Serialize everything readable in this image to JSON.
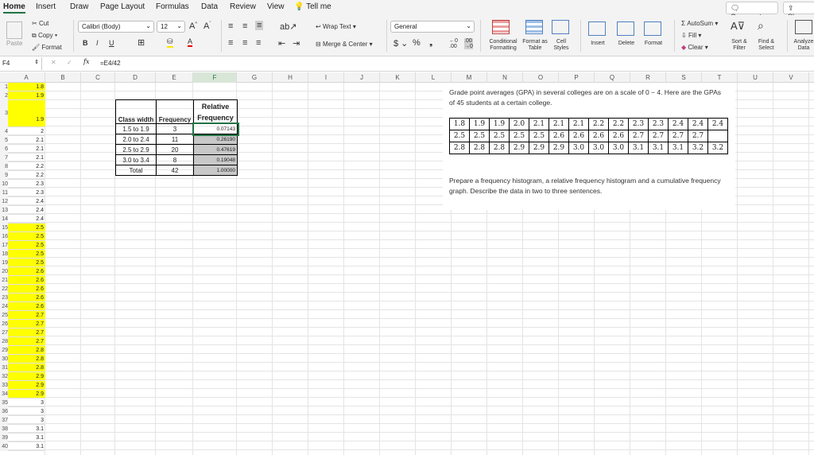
{
  "menu": {
    "tabs": [
      "Home",
      "Insert",
      "Draw",
      "Page Layout",
      "Formulas",
      "Data",
      "Review",
      "View"
    ],
    "tell_me": "Tell me",
    "comments": "Comments",
    "share": "Share"
  },
  "ribbon": {
    "paste": "Paste",
    "cut": "Cut",
    "copy": "Copy",
    "format": "Format",
    "font_name": "Calibri (Body)",
    "font_size": "12",
    "wrap_text": "Wrap Text",
    "merge_center": "Merge & Center",
    "number_format": "General",
    "conditional_formatting": "Conditional Formatting",
    "format_as_table": "Format as Table",
    "cell_styles": "Cell Styles",
    "insert": "Insert",
    "delete": "Delete",
    "format_cells": "Format",
    "autosum": "AutoSum",
    "fill": "Fill",
    "clear": "Clear",
    "sort_filter": "Sort & Filter",
    "find_select": "Find & Select",
    "analyze_data": "Analyze Data"
  },
  "formula_bar": {
    "name_box": "F4",
    "fx": "fx",
    "formula": "=E4/42"
  },
  "columns": [
    "A",
    "B",
    "C",
    "D",
    "E",
    "F",
    "G",
    "H",
    "I",
    "J",
    "K",
    "L",
    "M",
    "N",
    "O",
    "P",
    "Q",
    "R",
    "S",
    "T",
    "U",
    "V"
  ],
  "col_a": [
    {
      "row": "1",
      "v": "1.8",
      "y": true
    },
    {
      "row": "2",
      "v": "1.9",
      "y": true
    },
    {
      "row": "3",
      "v": "1.9",
      "y": true
    },
    {
      "row": "4",
      "v": "2",
      "y": false
    },
    {
      "row": "5",
      "v": "2.1",
      "y": false
    },
    {
      "row": "6",
      "v": "2.1",
      "y": false
    },
    {
      "row": "7",
      "v": "2.1",
      "y": false
    },
    {
      "row": "8",
      "v": "2.2",
      "y": false
    },
    {
      "row": "9",
      "v": "2.2",
      "y": false
    },
    {
      "row": "10",
      "v": "2.3",
      "y": false
    },
    {
      "row": "11",
      "v": "2.3",
      "y": false
    },
    {
      "row": "12",
      "v": "2.4",
      "y": false
    },
    {
      "row": "13",
      "v": "2.4",
      "y": false
    },
    {
      "row": "14",
      "v": "2.4",
      "y": false
    },
    {
      "row": "15",
      "v": "2.5",
      "y": true
    },
    {
      "row": "16",
      "v": "2.5",
      "y": true
    },
    {
      "row": "17",
      "v": "2.5",
      "y": true
    },
    {
      "row": "18",
      "v": "2.5",
      "y": true
    },
    {
      "row": "19",
      "v": "2.5",
      "y": true
    },
    {
      "row": "20",
      "v": "2.6",
      "y": true
    },
    {
      "row": "21",
      "v": "2.6",
      "y": true
    },
    {
      "row": "22",
      "v": "2.6",
      "y": true
    },
    {
      "row": "23",
      "v": "2.6",
      "y": true
    },
    {
      "row": "24",
      "v": "2.6",
      "y": true
    },
    {
      "row": "25",
      "v": "2.7",
      "y": true
    },
    {
      "row": "26",
      "v": "2.7",
      "y": true
    },
    {
      "row": "27",
      "v": "2.7",
      "y": true
    },
    {
      "row": "28",
      "v": "2.7",
      "y": true
    },
    {
      "row": "29",
      "v": "2.8",
      "y": true
    },
    {
      "row": "30",
      "v": "2.8",
      "y": true
    },
    {
      "row": "31",
      "v": "2.8",
      "y": true
    },
    {
      "row": "32",
      "v": "2.9",
      "y": true
    },
    {
      "row": "33",
      "v": "2.9",
      "y": true
    },
    {
      "row": "34",
      "v": "2.9",
      "y": true
    },
    {
      "row": "35",
      "v": "3",
      "y": false
    },
    {
      "row": "36",
      "v": "3",
      "y": false
    },
    {
      "row": "37",
      "v": "3",
      "y": false
    },
    {
      "row": "38",
      "v": "3.1",
      "y": false
    },
    {
      "row": "39",
      "v": "3.1",
      "y": false
    },
    {
      "row": "40",
      "v": "3.1",
      "y": false
    }
  ],
  "freq_table": {
    "headers": {
      "class_width": "Class width",
      "frequency": "Frequency",
      "relative": "Relative",
      "relative2": "Frequency"
    },
    "rows": [
      {
        "cls": "1.5 to 1.9",
        "freq": "3",
        "rel": "0.07143"
      },
      {
        "cls": "2.0 to 2.4",
        "freq": "11",
        "rel": "0.26190"
      },
      {
        "cls": "2.5 to 2.9",
        "freq": "20",
        "rel": "0.47619"
      },
      {
        "cls": "3.0 to 3.4",
        "freq": "8",
        "rel": "0.19048"
      }
    ],
    "total": {
      "label": "Total",
      "freq": "42",
      "rel": "1.00000"
    }
  },
  "problem": {
    "intro": "Grade point averages (GPA) in several colleges are on a scale of 0 − 4. Here are the GPAs of 45 students at a certain college.",
    "gpa_rows": [
      [
        "1.8",
        "1.9",
        "1.9",
        "2.0",
        "2.1",
        "2.1",
        "2.1",
        "2.2",
        "2.2",
        "2.3",
        "2.3",
        "2.4",
        "2.4",
        "2.4"
      ],
      [
        "2.5",
        "2.5",
        "2.5",
        "2.5",
        "2.5",
        "2.6",
        "2.6",
        "2.6",
        "2.6",
        "2.7",
        "2.7",
        "2.7",
        "2.7"
      ],
      [
        "2.8",
        "2.8",
        "2.8",
        "2.9",
        "2.9",
        "2.9",
        "3.0",
        "3.0",
        "3.0",
        "3.1",
        "3.1",
        "3.1",
        "3.2",
        "3.2"
      ]
    ],
    "task": "Prepare a frequency histogram, a relative frequency histogram and a cumulative frequency graph. Describe the data in two to three sentences."
  }
}
